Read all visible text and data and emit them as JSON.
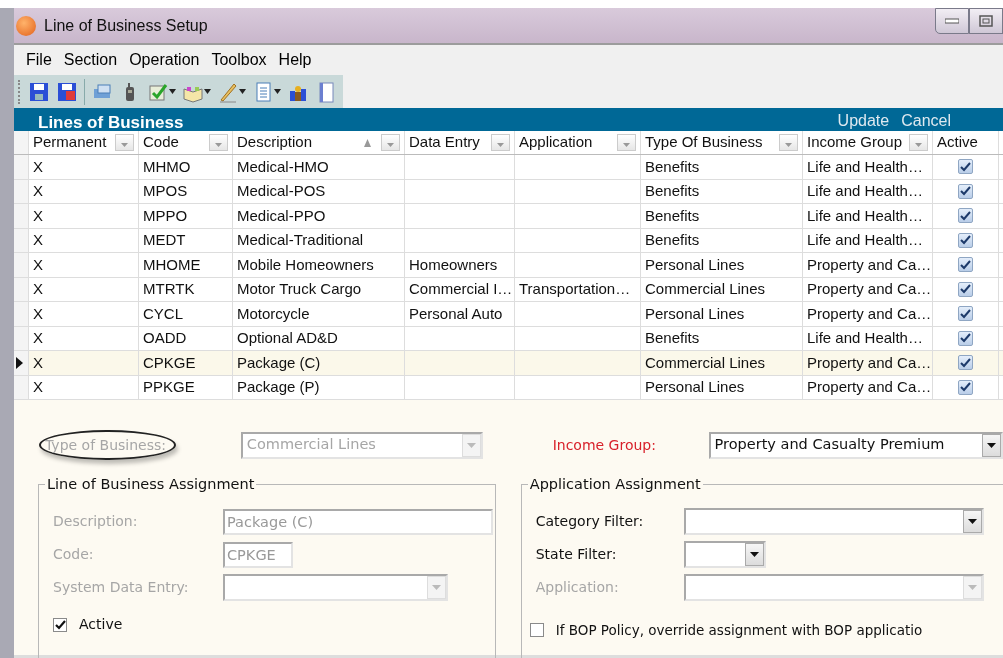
{
  "window": {
    "title": "Line of Business Setup"
  },
  "menu": [
    "File",
    "Section",
    "Operation",
    "Toolbox",
    "Help"
  ],
  "grid": {
    "title": "Lines of Business",
    "actions": [
      "Update",
      "Cancel"
    ],
    "columns": [
      {
        "label": "Permanent",
        "sorted": false
      },
      {
        "label": "Code",
        "sorted": false
      },
      {
        "label": "Description",
        "sorted": true
      },
      {
        "label": "Data Entry",
        "sorted": false
      },
      {
        "label": "Application",
        "sorted": false
      },
      {
        "label": "Type Of Business",
        "sorted": false
      },
      {
        "label": "Income Group",
        "sorted": false
      },
      {
        "label": "Active",
        "sorted": false
      }
    ],
    "rows": [
      {
        "permanent": "X",
        "code": "MHMO",
        "description": "Medical-HMO",
        "data_entry": "",
        "application": "",
        "type": "Benefits",
        "income_group": "Life and Health…",
        "active": true,
        "selected": false
      },
      {
        "permanent": "X",
        "code": "MPOS",
        "description": "Medical-POS",
        "data_entry": "",
        "application": "",
        "type": "Benefits",
        "income_group": "Life and Health…",
        "active": true,
        "selected": false
      },
      {
        "permanent": "X",
        "code": "MPPO",
        "description": "Medical-PPO",
        "data_entry": "",
        "application": "",
        "type": "Benefits",
        "income_group": "Life and Health…",
        "active": true,
        "selected": false
      },
      {
        "permanent": "X",
        "code": "MEDT",
        "description": "Medical-Traditional",
        "data_entry": "",
        "application": "",
        "type": "Benefits",
        "income_group": "Life and Health…",
        "active": true,
        "selected": false
      },
      {
        "permanent": "X",
        "code": "MHOME",
        "description": "Mobile Homeowners",
        "data_entry": "Homeowners",
        "application": "",
        "type": "Personal Lines",
        "income_group": "Property and Ca…",
        "active": true,
        "selected": false
      },
      {
        "permanent": "X",
        "code": "MTRTK",
        "description": "Motor Truck Cargo",
        "data_entry": "Commercial I…",
        "application": "Transportation…",
        "type": "Commercial Lines",
        "income_group": "Property and Ca…",
        "active": true,
        "selected": false
      },
      {
        "permanent": "X",
        "code": "CYCL",
        "description": "Motorcycle",
        "data_entry": "Personal Auto",
        "application": "",
        "type": "Personal Lines",
        "income_group": "Property and Ca…",
        "active": true,
        "selected": false
      },
      {
        "permanent": "X",
        "code": "OADD",
        "description": "Optional AD&D",
        "data_entry": "",
        "application": "",
        "type": "Benefits",
        "income_group": "Life and Health…",
        "active": true,
        "selected": false
      },
      {
        "permanent": "X",
        "code": "CPKGE",
        "description": "Package (C)",
        "data_entry": "",
        "application": "",
        "type": "Commercial Lines",
        "income_group": "Property and Ca…",
        "active": true,
        "selected": true
      },
      {
        "permanent": "X",
        "code": "PPKGE",
        "description": "Package (P)",
        "data_entry": "",
        "application": "",
        "type": "Personal Lines",
        "income_group": "Property and Ca…",
        "active": true,
        "selected": false
      }
    ]
  },
  "form": {
    "type_of_business": {
      "label": "Type of Business:",
      "value": "Commercial Lines",
      "disabled": true,
      "circled": true
    },
    "income_group": {
      "label": "Income Group:",
      "value": "Property and Casualty Premium",
      "required": true
    },
    "lob_assignment": {
      "title": "Line of Business Assignment",
      "fields": [
        {
          "kind": "text",
          "label": "Description:",
          "value": "Package (C)",
          "disabled": true
        },
        {
          "kind": "text",
          "label": "Code:",
          "value": "CPKGE",
          "disabled": true
        },
        {
          "kind": "select",
          "label": "System Data Entry:",
          "disabled": true
        }
      ],
      "active": {
        "label": "Active",
        "checked": true
      }
    },
    "app_assignment": {
      "title": "Application Assignment",
      "fields": [
        {
          "kind": "select",
          "label": "Category Filter:",
          "disabled": false
        },
        {
          "kind": "select",
          "label": "State Filter:",
          "disabled": false
        },
        {
          "kind": "select",
          "label": "Application:",
          "disabled": true
        }
      ],
      "override": {
        "label": "If BOP Policy, override assignment with BOP applicatio",
        "checked": false
      }
    }
  }
}
